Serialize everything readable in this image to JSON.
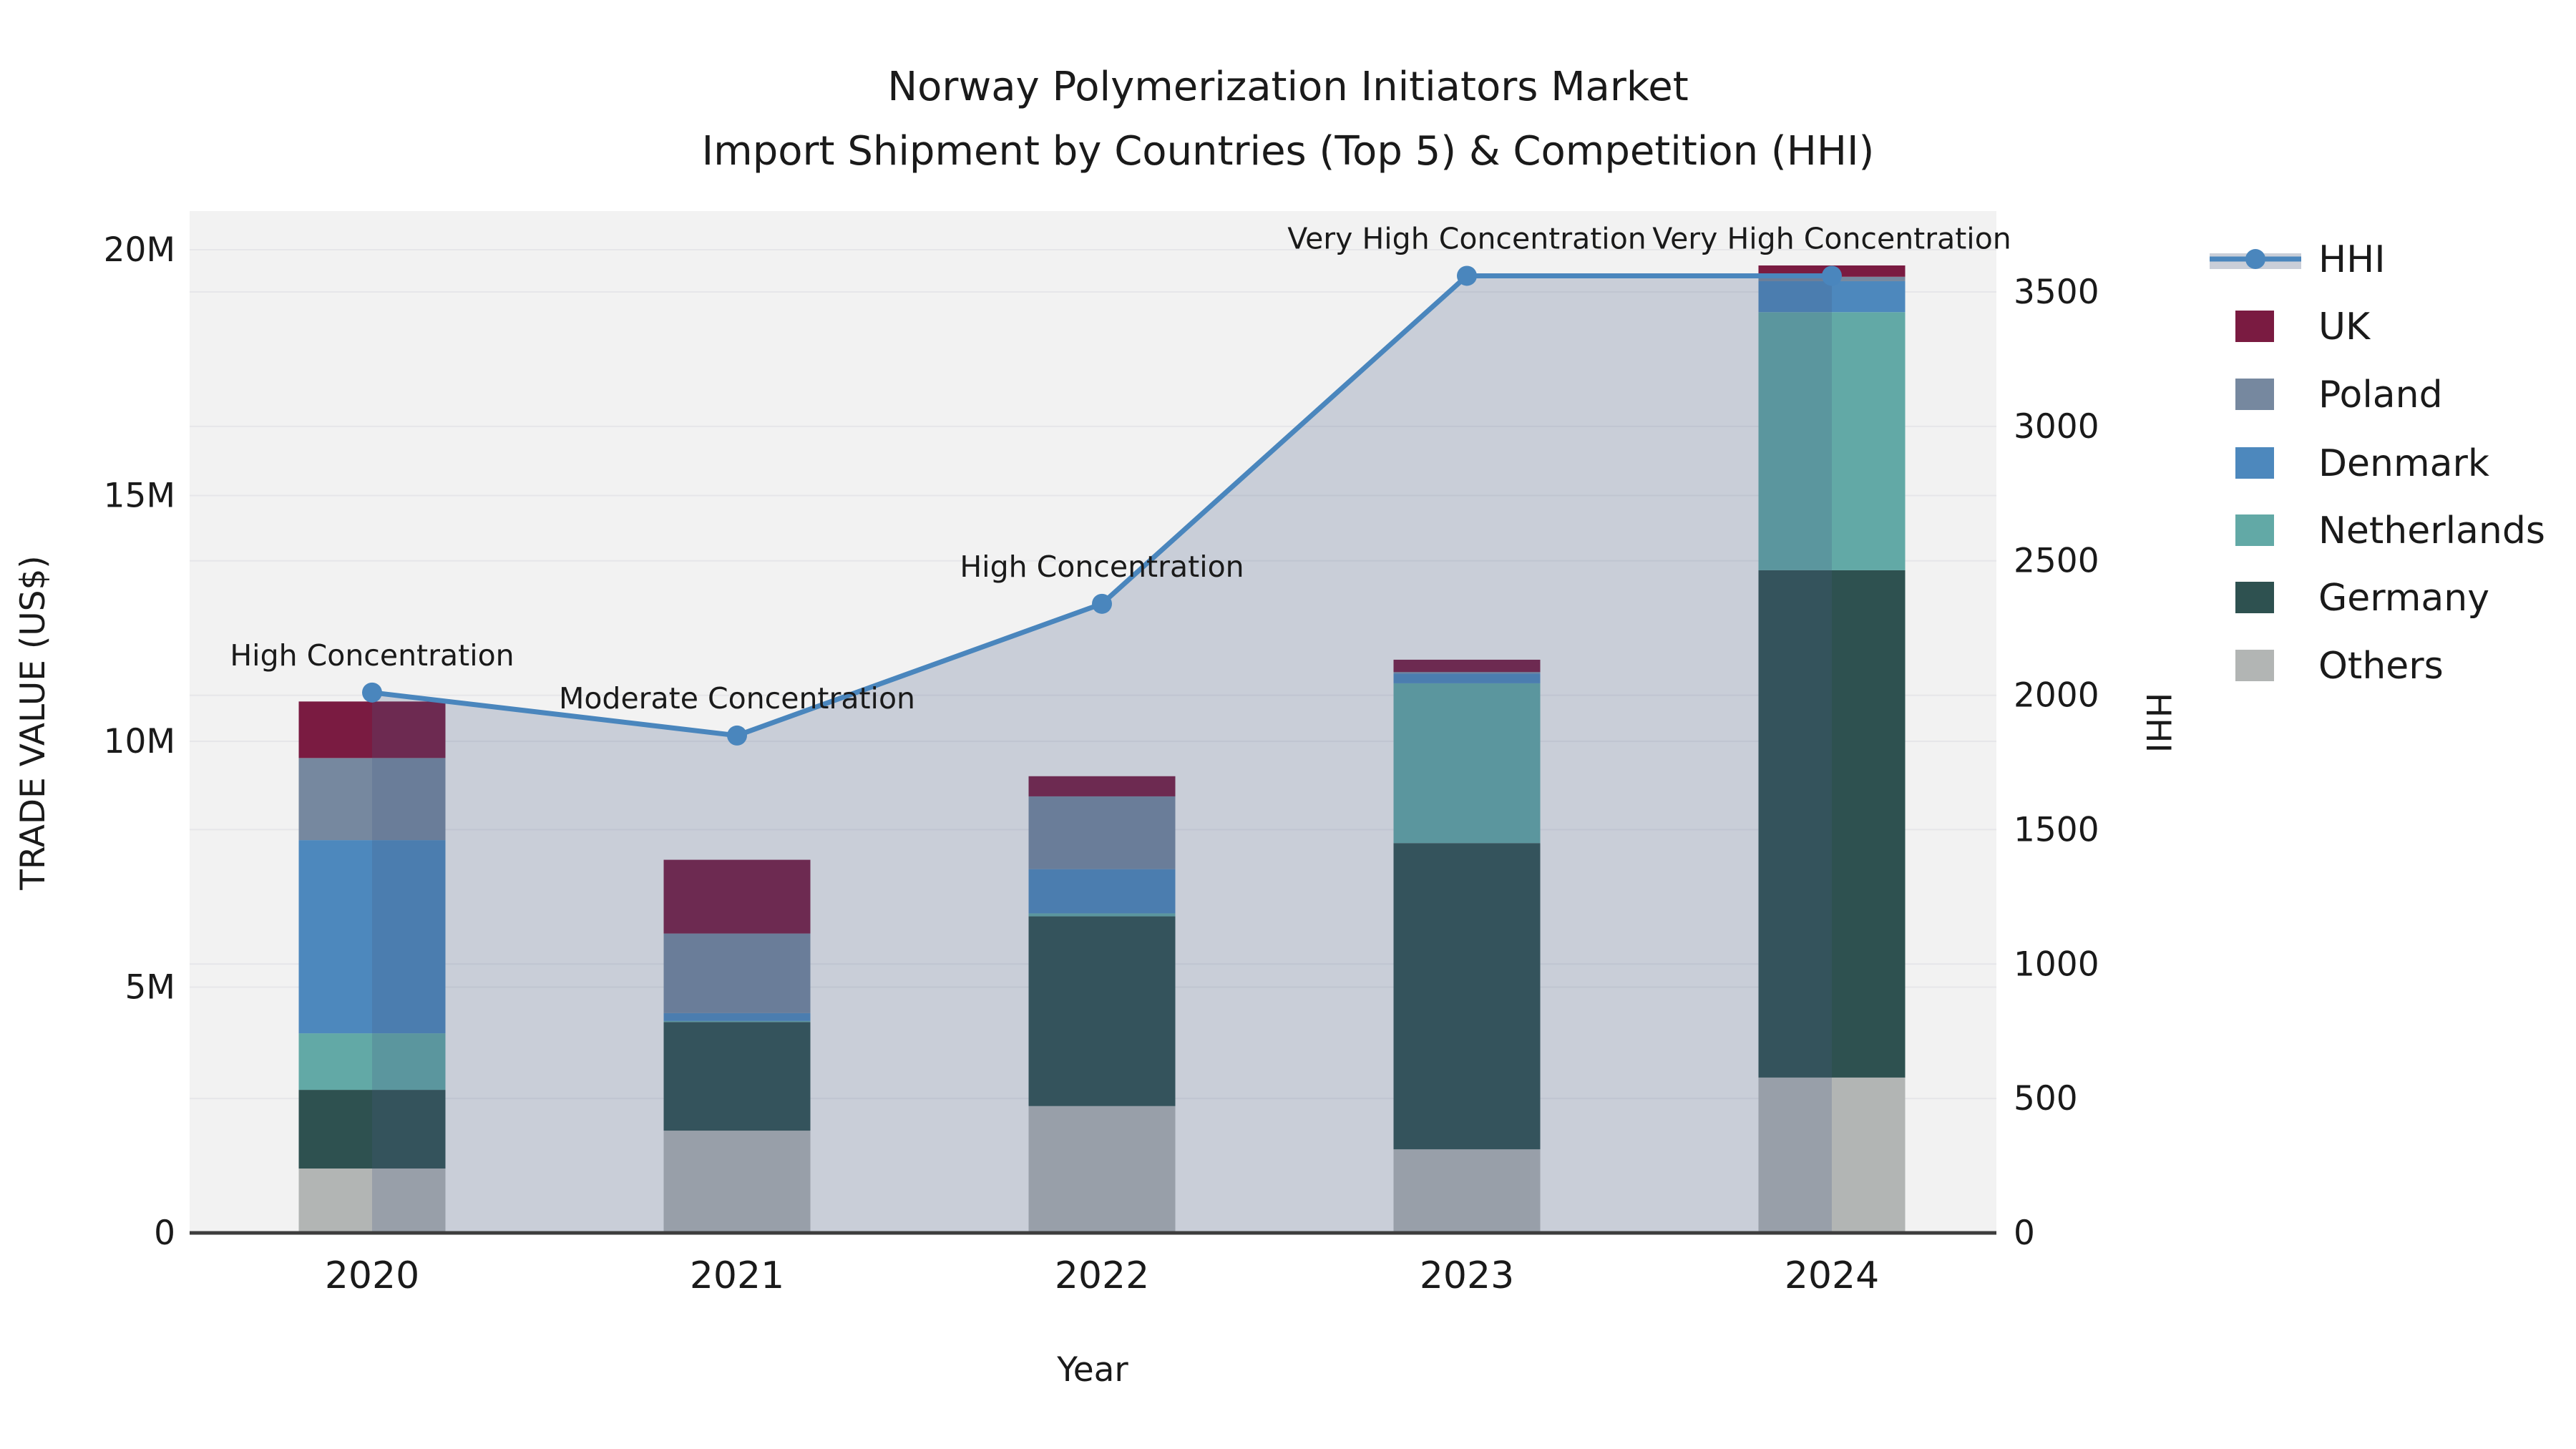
{
  "chart_data": {
    "type": "bar+line",
    "title_line1": "Norway Polymerization Initiators Market",
    "title_line2": "Import Shipment by Countries (Top 5) & Competition (HHI)",
    "x_label": "Year",
    "y_left_label": "TRADE VALUE (US$)",
    "y_right_label": "HHI",
    "unit": "US$ millions",
    "categories": [
      "2020",
      "2021",
      "2022",
      "2023",
      "2024"
    ],
    "y_left_ticks": [
      {
        "value": 0,
        "label": "0"
      },
      {
        "value": 5,
        "label": "5M"
      },
      {
        "value": 10,
        "label": "10M"
      },
      {
        "value": 15,
        "label": "15M"
      },
      {
        "value": 20,
        "label": "20M"
      }
    ],
    "y_right_ticks": [
      {
        "value": 0,
        "label": "0"
      },
      {
        "value": 500,
        "label": "500"
      },
      {
        "value": 1000,
        "label": "1000"
      },
      {
        "value": 1500,
        "label": "1500"
      },
      {
        "value": 2000,
        "label": "2000"
      },
      {
        "value": 2500,
        "label": "2500"
      },
      {
        "value": 3000,
        "label": "3000"
      },
      {
        "value": 3500,
        "label": "3500"
      }
    ],
    "series": [
      {
        "name": "Others",
        "color": "#b2b5b4",
        "values_m": [
          1.31,
          2.08,
          2.58,
          1.7,
          3.16
        ]
      },
      {
        "name": "Germany",
        "color": "#2e5150",
        "values_m": [
          1.6,
          2.21,
          3.86,
          6.23,
          10.32
        ]
      },
      {
        "name": "Netherlands",
        "color": "#62a9a6",
        "values_m": [
          1.15,
          0.02,
          0.06,
          3.25,
          5.25
        ]
      },
      {
        "name": "Denmark",
        "color": "#4d88bd",
        "values_m": [
          3.93,
          0.16,
          0.9,
          0.2,
          0.63
        ]
      },
      {
        "name": "Poland",
        "color": "#76889f",
        "values_m": [
          1.67,
          1.62,
          1.48,
          0.03,
          0.09
        ]
      },
      {
        "name": "UK",
        "color": "#7a1b41",
        "values_m": [
          1.15,
          1.5,
          0.41,
          0.25,
          0.23
        ]
      }
    ],
    "hhi": {
      "name": "HHI",
      "line_color": "#4a86bd",
      "area_overlay_rgba": [
        73,
        93,
        135,
        0.24
      ],
      "values": [
        2010,
        1850,
        2340,
        3560,
        3560
      ],
      "annotations": [
        "High Concentration",
        "Moderate Concentration",
        "High Concentration",
        "Very High Concentration",
        "Very High Concentration"
      ]
    },
    "legend_order": [
      "HHI",
      "UK",
      "Poland",
      "Denmark",
      "Netherlands",
      "Germany",
      "Others"
    ],
    "legend_area_swatch_color": "#c9ced8",
    "plot_background": "#f2f2f2",
    "grid_color": "#e6e6e9",
    "axis_line_color": "#3d3d3d",
    "y_left_axis_max_m": 20.78,
    "y_right_axis_max": 3800
  }
}
